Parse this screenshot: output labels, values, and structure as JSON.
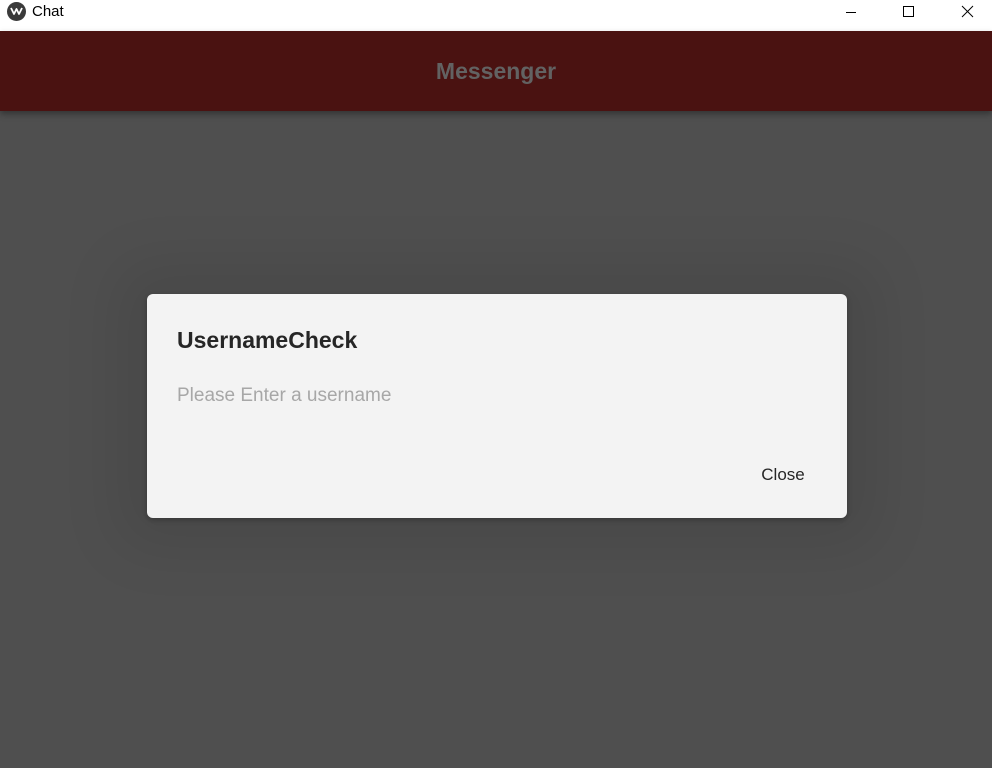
{
  "window": {
    "title": "Chat",
    "controls": {
      "minimize_icon": "minimize-icon",
      "maximize_icon": "maximize-icon",
      "close_icon": "close-icon"
    }
  },
  "appbar": {
    "title": "Messenger",
    "color": "#4a1211"
  },
  "dialog": {
    "title": "UsernameCheck",
    "message": "Please Enter a username",
    "close_label": "Close"
  },
  "colors": {
    "overlay": "#4f4f4f",
    "dialog_background": "#f3f3f3"
  }
}
